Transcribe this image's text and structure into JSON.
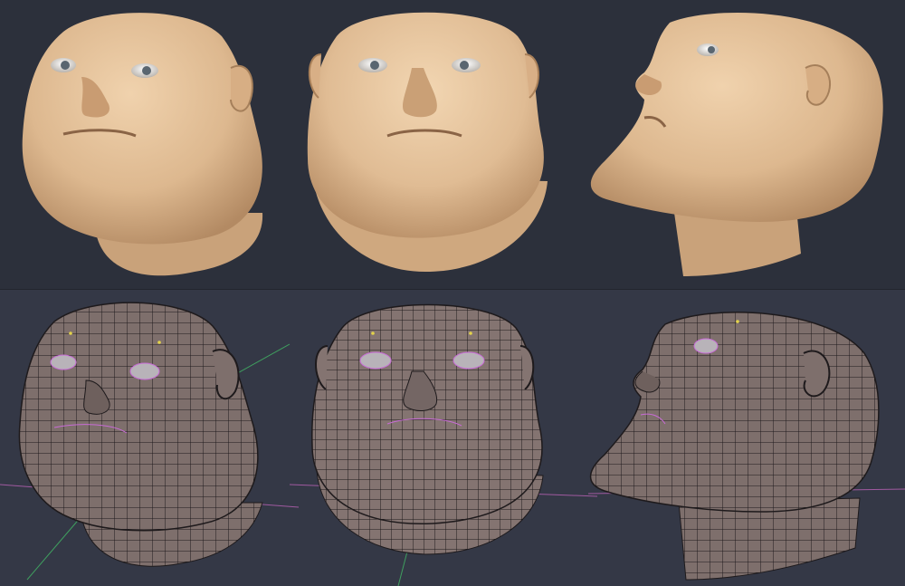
{
  "image": {
    "subject": "3d-character-head-turnaround",
    "rows": [
      {
        "name": "shaded-render",
        "views": [
          "three-quarter-left",
          "front",
          "side-right"
        ]
      },
      {
        "name": "mesh-wireframe",
        "views": [
          "three-quarter-left",
          "front",
          "side-right"
        ]
      }
    ],
    "colors": {
      "background_top": "#2c303b",
      "background_bottom": "#343846",
      "skin": "#e2c09a",
      "skin_shadow": "#b8916a",
      "mesh_fill": "#7e6f6c",
      "mesh_lines": "#1e1a1c",
      "vertex_dots": "#c86bd6",
      "axis_green": "#3f9f5f",
      "axis_magenta": "#a05aa0"
    }
  }
}
